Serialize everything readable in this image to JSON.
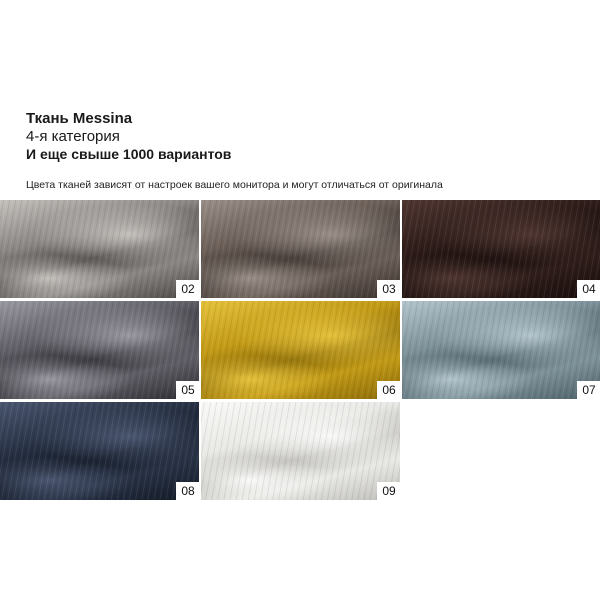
{
  "header": {
    "title": "Ткань Messina",
    "category": "4-я категория",
    "variants": "И еще свыше 1000 вариантов"
  },
  "note": "Цвета тканей зависят от настроек вашего монитора и могут отличаться от оригинала",
  "swatches": [
    {
      "number": "02",
      "color": "#8a8784",
      "dark": "#4a4745",
      "light": "#c4c1bd"
    },
    {
      "number": "03",
      "color": "#6a5e57",
      "dark": "#3a312d",
      "light": "#9a8f88"
    },
    {
      "number": "04",
      "color": "#2f1d1a",
      "dark": "#170c0a",
      "light": "#4f3631"
    },
    {
      "number": "05",
      "color": "#5f5e66",
      "dark": "#2c2b31",
      "light": "#9a99a2"
    },
    {
      "number": "06",
      "color": "#c29a16",
      "dark": "#8a6a06",
      "light": "#e5c13a"
    },
    {
      "number": "07",
      "color": "#7e929a",
      "dark": "#4c5e66",
      "light": "#b3c5cc"
    },
    {
      "number": "08",
      "color": "#283245",
      "dark": "#131a27",
      "light": "#4a5670"
    },
    {
      "number": "09",
      "color": "#e9e9e6",
      "dark": "#bdbcb8",
      "light": "#f9f9f7"
    }
  ]
}
